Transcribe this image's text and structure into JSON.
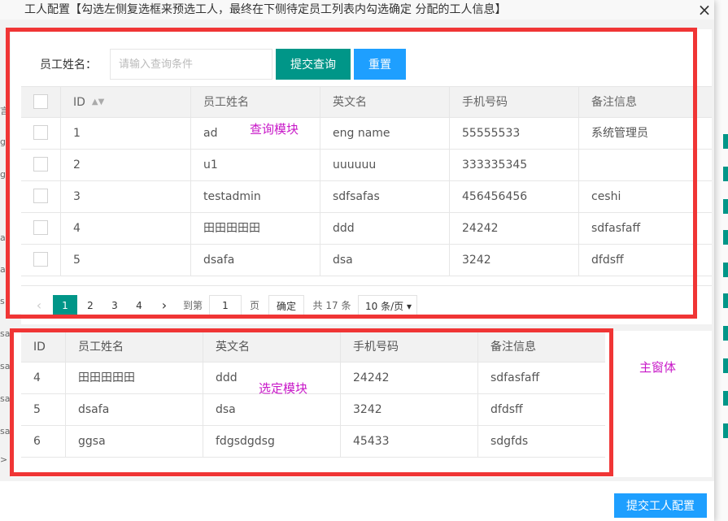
{
  "dialog": {
    "title": "工人配置【勾选左侧复选框来预选工人，最终在下侧待定员工列表内勾选确定 分配的工人信息】",
    "close_glyph": "×",
    "submit_label": "提交工人配置"
  },
  "search": {
    "label": "员工姓名：",
    "placeholder": "请输入查询条件",
    "query_label": "提交查询",
    "reset_label": "重置"
  },
  "query_table": {
    "headers": {
      "id": "ID",
      "name": "员工姓名",
      "en": "英文名",
      "phone": "手机号码",
      "note": "备注信息",
      "sort_glyph": "▲▼"
    },
    "rows": [
      {
        "id": "1",
        "name": "ad",
        "en": "eng name",
        "phone": "55555533",
        "note": "系统管理员"
      },
      {
        "id": "2",
        "name": "u1",
        "en": "uuuuuu",
        "phone": "333335345",
        "note": ""
      },
      {
        "id": "3",
        "name": "testadmin",
        "en": "sdfsafas",
        "phone": "456456456",
        "note": "ceshi"
      },
      {
        "id": "4",
        "name": "田田田田田",
        "en": "ddd",
        "phone": "24242",
        "note": "sdfasfaff"
      },
      {
        "id": "5",
        "name": "dsafa",
        "en": "dsa",
        "phone": "3242",
        "note": "dfdsff"
      }
    ]
  },
  "pager": {
    "prev": "‹",
    "next": "›",
    "pages": [
      "1",
      "2",
      "3",
      "4"
    ],
    "current": "1",
    "goto_label": "到第",
    "goto_value": "1",
    "page_unit": "页",
    "confirm_label": "确定",
    "total": "共 17 条",
    "page_size": "10 条/页 ▾"
  },
  "selected_table": {
    "headers": {
      "id": "ID",
      "name": "员工姓名",
      "en": "英文名",
      "phone": "手机号码",
      "note": "备注信息"
    },
    "rows": [
      {
        "id": "4",
        "name": "田田田田田",
        "en": "ddd",
        "phone": "24242",
        "note": "sdfasfaff"
      },
      {
        "id": "5",
        "name": "dsafa",
        "en": "dsa",
        "phone": "3242",
        "note": "dfdsff"
      },
      {
        "id": "6",
        "name": "ggsa",
        "en": "fdgsdgdsg",
        "phone": "45433",
        "note": "sdgfds"
      }
    ]
  },
  "annotations": {
    "query_module": "查询模块",
    "selected_module": "选定模块",
    "main_window": "主窗体",
    "color": "#c818c8",
    "box_color": "#f03535"
  },
  "background_fragments": [
    "言",
    "g",
    "g",
    "a",
    "a",
    "s",
    "sa",
    "sa",
    "sa",
    "sa",
    ">"
  ],
  "colors": {
    "primary_green": "#009688",
    "primary_blue": "#1e9fff"
  }
}
